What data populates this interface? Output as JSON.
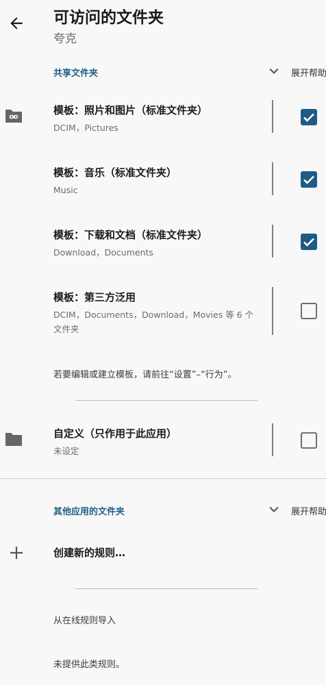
{
  "header": {
    "title": "可访问的文件夹",
    "subtitle": "夸克"
  },
  "shared_section": {
    "title": "共享文件夹",
    "expand_help": "展开帮助",
    "items": [
      {
        "title": "模板：照片和图片（标准文件夹）",
        "subtitle": "DCIM，Pictures",
        "checked": true,
        "icon": "link-folder-icon"
      },
      {
        "title": "模板：音乐（标准文件夹）",
        "subtitle": "Music",
        "checked": true
      },
      {
        "title": "模板：下载和文档（标准文件夹）",
        "subtitle": "Download，Documents",
        "checked": true
      },
      {
        "title": "模板：第三方泛用",
        "subtitle": "DCIM，Documents，Download，Movies 等 6 个文件夹",
        "checked": false
      }
    ],
    "template_note": "若要编辑或建立模板，请前往“设置”–“行为”。",
    "custom": {
      "title": "自定义（只作用于此应用）",
      "subtitle": "未设定",
      "checked": false,
      "icon": "folder-icon"
    }
  },
  "other_section": {
    "title": "其他应用的文件夹",
    "expand_help": "展开帮助",
    "add_rule": "创建新的规则…",
    "import_label": "从在线规则导入",
    "empty_note": "未提供此类规则。"
  },
  "colors": {
    "accent": "#1e5c86",
    "section_title": "#1f5e86"
  }
}
